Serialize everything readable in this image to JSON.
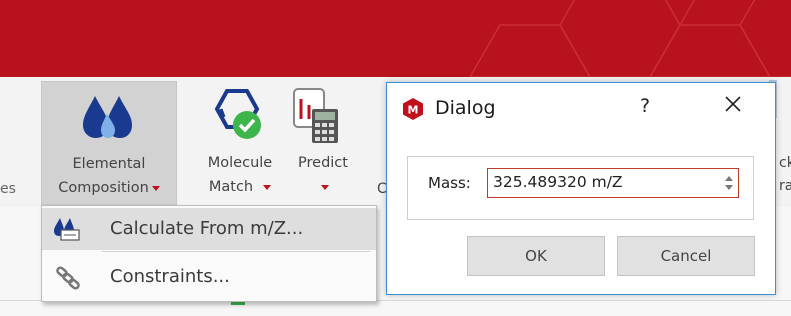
{
  "ribbon": {
    "left_partial_label": "es",
    "elemental": {
      "line1": "Elemental",
      "line2": "Composition"
    },
    "molecule_match": {
      "line1": "Molecule",
      "line2": "Match"
    },
    "predict": {
      "line1": "Predict"
    },
    "hidden_partial_c": "C",
    "right_partial_line1": "ck",
    "right_partial_line2": "ra"
  },
  "menu": {
    "items": [
      {
        "label": "Calculate From m/Z...",
        "icon": "calculate-icon",
        "highlighted": true
      },
      {
        "label": "Constraints...",
        "icon": "chain-link-icon",
        "highlighted": false
      }
    ]
  },
  "dialog": {
    "title": "Dialog",
    "help": "?",
    "mass_label": "Mass:",
    "mass_value": "325.489320 m/Z",
    "ok_label": "OK",
    "cancel_label": "Cancel"
  },
  "colors": {
    "brand_red": "#b8121c",
    "dialog_border": "#3b8fd6",
    "input_border": "#c0392b",
    "accent_green": "#3eb54a"
  }
}
